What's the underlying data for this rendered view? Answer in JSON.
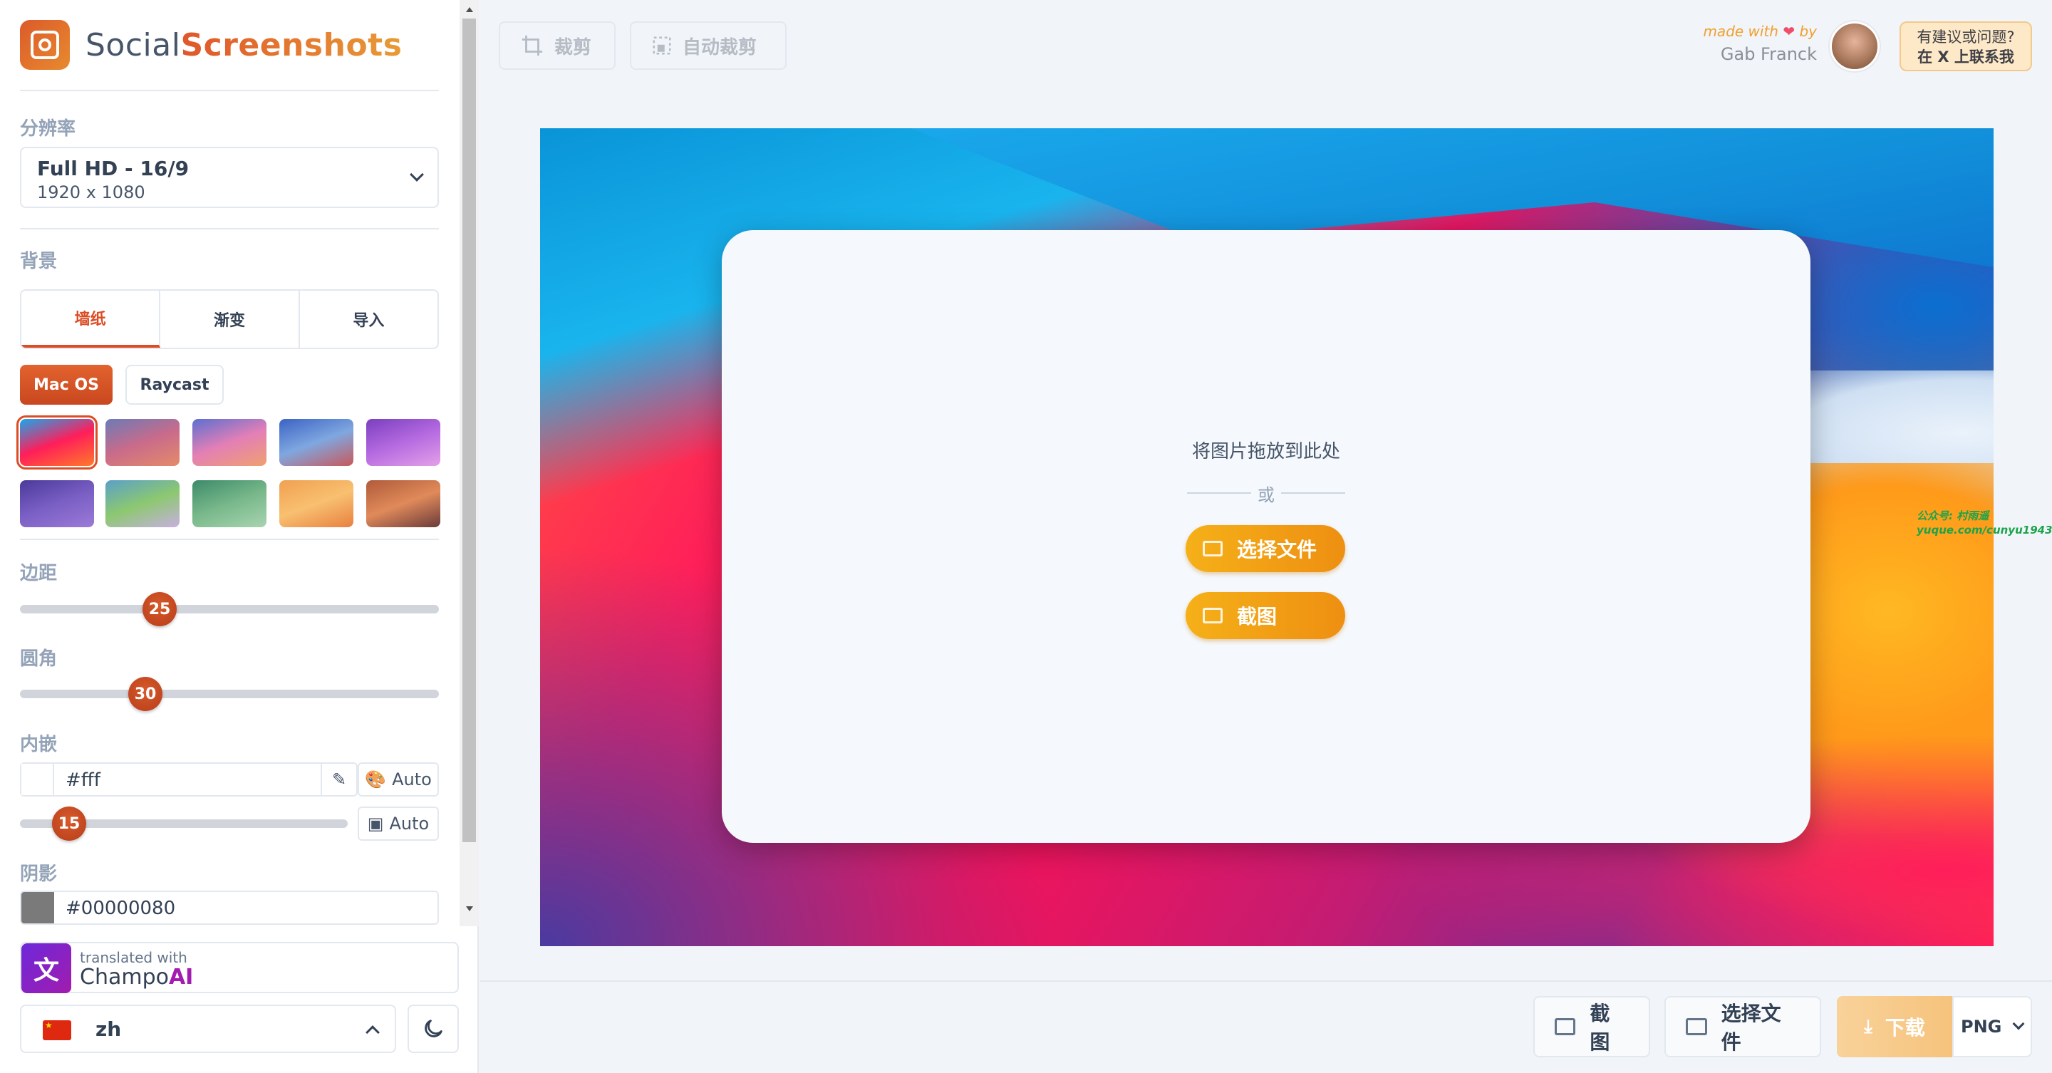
{
  "brand": {
    "part1": "Social",
    "part2": "Screenshots"
  },
  "resolution": {
    "label": "分辨率",
    "name": "Full HD - 16/9",
    "size": "1920 x 1080"
  },
  "background": {
    "label": "背景",
    "tabs": [
      "墙纸",
      "渐变",
      "导入"
    ],
    "active_tab": "墙纸",
    "sources": [
      "Mac OS",
      "Raycast"
    ],
    "active_source": "Mac OS",
    "wallpapers": [
      {
        "name": "big-sur-red",
        "colors": [
          "#1aa7ec",
          "#ff1e5a",
          "#ff7a2a"
        ]
      },
      {
        "name": "big-sur-dusk",
        "colors": [
          "#6b7bb8",
          "#c96b8a",
          "#e58a6a"
        ]
      },
      {
        "name": "big-sur-pink",
        "colors": [
          "#5c6fd1",
          "#e37fb6",
          "#f0a070"
        ]
      },
      {
        "name": "big-sur-evening",
        "colors": [
          "#3b63c4",
          "#7fa7e0",
          "#c9585a"
        ]
      },
      {
        "name": "big-sur-purple",
        "colors": [
          "#7a3fbf",
          "#b56ae0",
          "#e4a0e8"
        ]
      },
      {
        "name": "monterey-violet",
        "colors": [
          "#4a3a9a",
          "#7a5fc4",
          "#9c7ad8"
        ]
      },
      {
        "name": "sonoma-green",
        "colors": [
          "#5aa0c8",
          "#8cc870",
          "#c8b0e0"
        ]
      },
      {
        "name": "sonoma-hills",
        "colors": [
          "#3c8a6a",
          "#78b88a",
          "#a8d4b0"
        ]
      },
      {
        "name": "ventura-orange",
        "colors": [
          "#f0a050",
          "#f8c070",
          "#e88040"
        ]
      },
      {
        "name": "ventura-dark",
        "colors": [
          "#b05a3a",
          "#e08a5a",
          "#6a3a3a"
        ]
      }
    ]
  },
  "padding": {
    "label": "边距",
    "value": 25
  },
  "radius": {
    "label": "圆角",
    "value": 30
  },
  "inset": {
    "label": "内嵌",
    "color": "#fff",
    "auto1": "Auto",
    "auto2": "Auto",
    "value": 15
  },
  "shadow": {
    "label": "阴影",
    "color": "#00000080"
  },
  "translation": {
    "line1": "translated with",
    "name1": "Champo",
    "name2": "AI"
  },
  "language": {
    "code": "zh"
  },
  "toolbar": {
    "crop": "裁剪",
    "auto_crop": "自动裁剪"
  },
  "credit": {
    "made_with": "made with",
    "by": "by",
    "author": "Gab Franck"
  },
  "suggest": {
    "line1": "有建议或问题?",
    "line2": "在 X 上联系我"
  },
  "dropzone": {
    "text": "将图片拖放到此处",
    "or": "或",
    "choose": "选择文件",
    "screenshot": "截图"
  },
  "watermark": {
    "line1": "公众号: 村雨遥",
    "line2": "yuque.com/cunyu1943"
  },
  "footer": {
    "screenshot": "截图",
    "choose": "选择文件",
    "download": "下载",
    "format": "PNG"
  },
  "colors": {
    "accent": "#dc4c25",
    "cta": "#f2a414"
  }
}
